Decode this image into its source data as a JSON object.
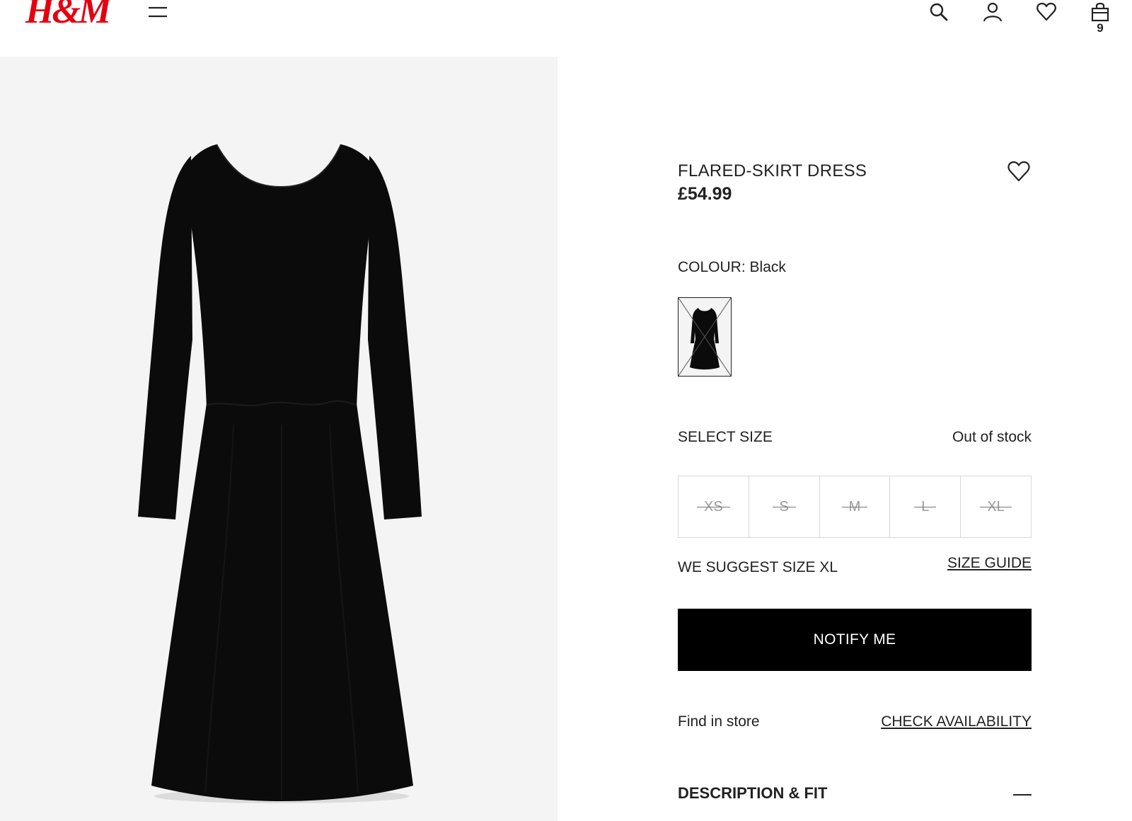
{
  "brand": {
    "logo_text": "H&M",
    "color": "#e50010"
  },
  "header": {
    "icons": [
      "menu-icon",
      "search-icon",
      "account-icon",
      "heart-icon",
      "shopping-bag-icon"
    ],
    "cart_count": "9"
  },
  "product": {
    "name": "FLARED-SKIRT DRESS",
    "price": "£54.99",
    "colour_label": "COLOUR:",
    "colour_value": "Black",
    "select_size_label": "SELECT SIZE",
    "stock_status": "Out of stock",
    "sizes": [
      {
        "label": "XS",
        "available": false
      },
      {
        "label": "S",
        "available": false
      },
      {
        "label": "M",
        "available": false
      },
      {
        "label": "L",
        "available": false
      },
      {
        "label": "XL",
        "available": false
      }
    ],
    "size_suggestion": "WE SUGGEST SIZE XL",
    "size_guide_label": "SIZE GUIDE",
    "notify_label": "NOTIFY ME",
    "find_in_store_label": "Find in store",
    "check_availability_label": "CHECK AVAILABILITY",
    "description_label": "DESCRIPTION & FIT"
  },
  "colors": {
    "text": "#222222",
    "button_bg": "#000000",
    "button_text": "#ffffff",
    "image_bg": "#f4f4f4",
    "dress": "#0b0b0b"
  }
}
